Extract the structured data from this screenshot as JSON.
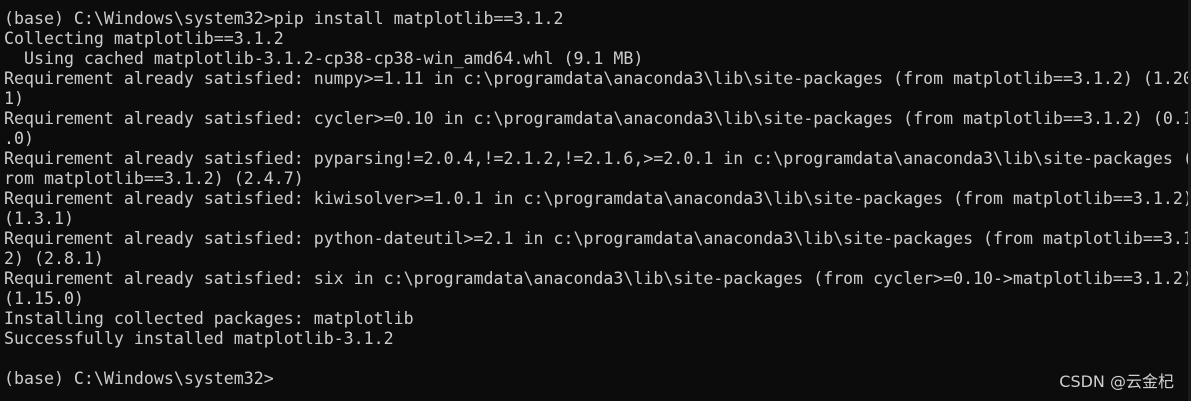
{
  "terminal": {
    "lines": [
      "(base) C:\\Windows\\system32>pip install matplotlib==3.1.2",
      "Collecting matplotlib==3.1.2",
      "  Using cached matplotlib-3.1.2-cp38-cp38-win_amd64.whl (9.1 MB)",
      "Requirement already satisfied: numpy>=1.11 in c:\\programdata\\anaconda3\\lib\\site-packages (from matplotlib==3.1.2) (1.20",
      "1)",
      "Requirement already satisfied: cycler>=0.10 in c:\\programdata\\anaconda3\\lib\\site-packages (from matplotlib==3.1.2) (0.1",
      ".0)",
      "Requirement already satisfied: pyparsing!=2.0.4,!=2.1.2,!=2.1.6,>=2.0.1 in c:\\programdata\\anaconda3\\lib\\site-packages (",
      "rom matplotlib==3.1.2) (2.4.7)",
      "Requirement already satisfied: kiwisolver>=1.0.1 in c:\\programdata\\anaconda3\\lib\\site-packages (from matplotlib==3.1.2)",
      "(1.3.1)",
      "Requirement already satisfied: python-dateutil>=2.1 in c:\\programdata\\anaconda3\\lib\\site-packages (from matplotlib==3.1",
      "2) (2.8.1)",
      "Requirement already satisfied: six in c:\\programdata\\anaconda3\\lib\\site-packages (from cycler>=0.10->matplotlib==3.1.2)",
      "(1.15.0)",
      "Installing collected packages: matplotlib",
      "Successfully installed matplotlib-3.1.2",
      "",
      "(base) C:\\Windows\\system32>"
    ]
  },
  "watermark": {
    "text": "CSDN @云金杞"
  },
  "colors": {
    "background": "#0c0c0c",
    "text": "#cccccc"
  }
}
